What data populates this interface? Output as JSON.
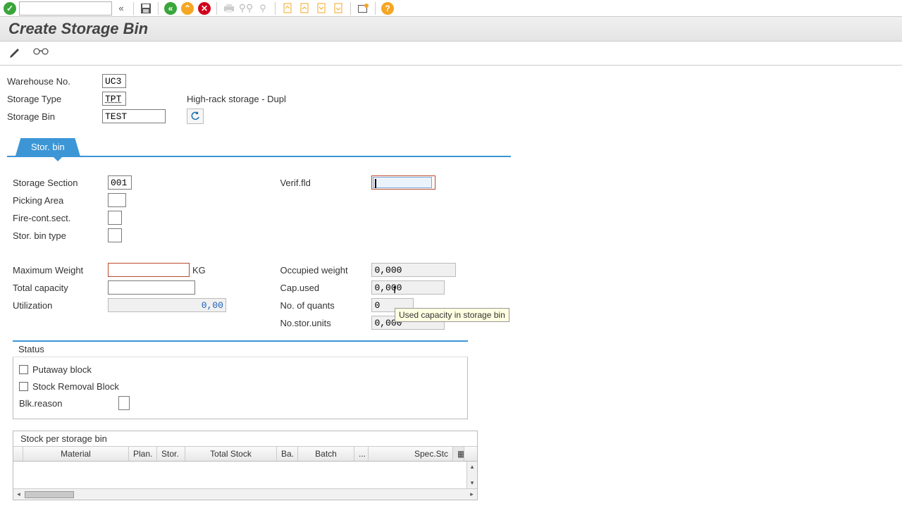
{
  "title": "Create Storage Bin",
  "header": {
    "warehouse_lbl": "Warehouse No.",
    "warehouse_val": "UC3",
    "storagetype_lbl": "Storage Type",
    "storagetype_val": "TPT",
    "storagetype_desc": "High-rack storage - Dupl",
    "storagebin_lbl": "Storage Bin",
    "storagebin_val": "TEST"
  },
  "tab": {
    "label": "Stor. bin"
  },
  "fields": {
    "storage_section_lbl": "Storage Section",
    "storage_section_val": "001",
    "picking_area_lbl": "Picking Area",
    "fire_lbl": "Fire-cont.sect.",
    "bintype_lbl": "Stor. bin type",
    "verif_lbl": "Verif.fld",
    "maxweight_lbl": "Maximum Weight",
    "maxweight_unit": "KG",
    "totalcap_lbl": "Total capacity",
    "util_lbl": "Utilization",
    "util_val": "0,00",
    "occweight_lbl": "Occupied weight",
    "occweight_val": "0,000",
    "capused_lbl": "Cap.used",
    "capused_val": "0,000",
    "noquants_lbl": "No. of quants",
    "noquants_val": "0",
    "storunits_lbl": "No.stor.units",
    "storunits_val": "0,000"
  },
  "status": {
    "title": "Status",
    "putaway": "Putaway block",
    "removal": "Stock Removal Block",
    "blkreason": "Blk.reason"
  },
  "grid": {
    "title": "Stock per storage bin",
    "cols": [
      "Material",
      "Plan.",
      "Stor.",
      "Total Stock",
      "Ba.",
      "Batch",
      "...",
      "Spec.Stc"
    ]
  },
  "tooltip": "Used capacity in storage bin"
}
